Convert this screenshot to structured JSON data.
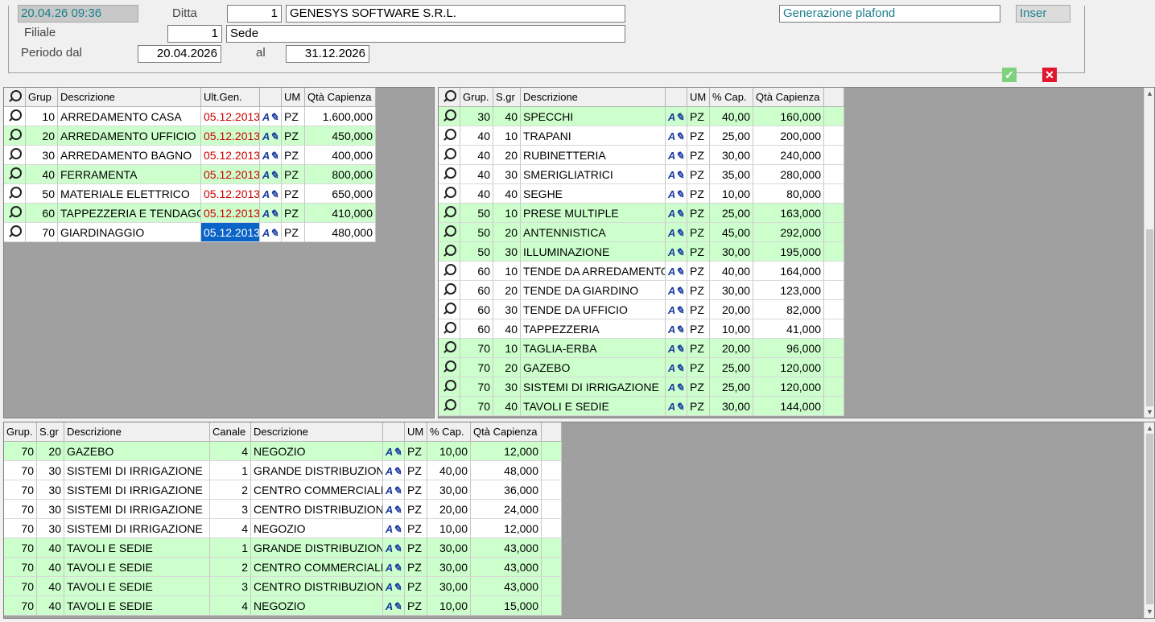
{
  "header": {
    "timestamp": "20.04.26 09:36",
    "ditta_label": "Ditta",
    "ditta_code": "1",
    "ditta_name": "GENESYS SOFTWARE S.R.L.",
    "filiale_label": "Filiale",
    "filiale_code": "1",
    "filiale_name": "Sede",
    "periodo_label": "Periodo dal",
    "periodo_from": "20.04.2026",
    "al_label": "al",
    "periodo_to": "31.12.2026",
    "title": "Generazione  plafond",
    "mode": "Inser",
    "ok_icon": "check-icon",
    "cancel_icon": "close-icon"
  },
  "groups_table": {
    "headers": [
      "",
      "Grup",
      "Descrizione",
      "Ult.Gen.",
      "",
      "UM",
      "Qtà Capienza"
    ],
    "rows": [
      {
        "grup": "10",
        "desc": "ARREDAMENTO CASA",
        "date": "05.12.2013",
        "um": "PZ",
        "qta": "1.600,000",
        "green": false
      },
      {
        "grup": "20",
        "desc": "ARREDAMENTO UFFICIO",
        "date": "05.12.2013",
        "um": "PZ",
        "qta": "450,000",
        "green": true
      },
      {
        "grup": "30",
        "desc": "ARREDAMENTO BAGNO",
        "date": "05.12.2013",
        "um": "PZ",
        "qta": "400,000",
        "green": false
      },
      {
        "grup": "40",
        "desc": "FERRAMENTA",
        "date": "05.12.2013",
        "um": "PZ",
        "qta": "800,000",
        "green": true
      },
      {
        "grup": "50",
        "desc": "MATERIALE ELETTRICO",
        "date": "05.12.2013",
        "um": "PZ",
        "qta": "650,000",
        "green": false
      },
      {
        "grup": "60",
        "desc": "TAPPEZZERIA E TENDAGGI",
        "date": "05.12.2013",
        "um": "PZ",
        "qta": "410,000",
        "green": true
      },
      {
        "grup": "70",
        "desc": "GIARDINAGGIO",
        "date": "05.12.2013",
        "um": "PZ",
        "qta": "480,000",
        "green": false,
        "selected": true
      }
    ]
  },
  "subgroups_table": {
    "headers": [
      "",
      "Grup.",
      "S.gr",
      "Descrizione",
      "",
      "UM",
      "% Cap.",
      "Qtà Capienza"
    ],
    "rows": [
      {
        "grup": "30",
        "sgr": "40",
        "desc": "SPECCHI",
        "um": "PZ",
        "cap": "40,00",
        "qta": "160,000",
        "green": true
      },
      {
        "grup": "40",
        "sgr": "10",
        "desc": "TRAPANI",
        "um": "PZ",
        "cap": "25,00",
        "qta": "200,000",
        "green": false
      },
      {
        "grup": "40",
        "sgr": "20",
        "desc": "RUBINETTERIA",
        "um": "PZ",
        "cap": "30,00",
        "qta": "240,000",
        "green": false
      },
      {
        "grup": "40",
        "sgr": "30",
        "desc": "SMERIGLIATRICI",
        "um": "PZ",
        "cap": "35,00",
        "qta": "280,000",
        "green": false
      },
      {
        "grup": "40",
        "sgr": "40",
        "desc": "SEGHE",
        "um": "PZ",
        "cap": "10,00",
        "qta": "80,000",
        "green": false
      },
      {
        "grup": "50",
        "sgr": "10",
        "desc": "PRESE MULTIPLE",
        "um": "PZ",
        "cap": "25,00",
        "qta": "163,000",
        "green": true
      },
      {
        "grup": "50",
        "sgr": "20",
        "desc": "ANTENNISTICA",
        "um": "PZ",
        "cap": "45,00",
        "qta": "292,000",
        "green": true
      },
      {
        "grup": "50",
        "sgr": "30",
        "desc": "ILLUMINAZIONE",
        "um": "PZ",
        "cap": "30,00",
        "qta": "195,000",
        "green": true
      },
      {
        "grup": "60",
        "sgr": "10",
        "desc": "TENDE DA ARREDAMENTO",
        "um": "PZ",
        "cap": "40,00",
        "qta": "164,000",
        "green": false
      },
      {
        "grup": "60",
        "sgr": "20",
        "desc": "TENDE DA GIARDINO",
        "um": "PZ",
        "cap": "30,00",
        "qta": "123,000",
        "green": false
      },
      {
        "grup": "60",
        "sgr": "30",
        "desc": "TENDE DA UFFICIO",
        "um": "PZ",
        "cap": "20,00",
        "qta": "82,000",
        "green": false
      },
      {
        "grup": "60",
        "sgr": "40",
        "desc": "TAPPEZZERIA",
        "um": "PZ",
        "cap": "10,00",
        "qta": "41,000",
        "green": false
      },
      {
        "grup": "70",
        "sgr": "10",
        "desc": "TAGLIA-ERBA",
        "um": "PZ",
        "cap": "20,00",
        "qta": "96,000",
        "green": true
      },
      {
        "grup": "70",
        "sgr": "20",
        "desc": "GAZEBO",
        "um": "PZ",
        "cap": "25,00",
        "qta": "120,000",
        "green": true
      },
      {
        "grup": "70",
        "sgr": "30",
        "desc": "SISTEMI DI IRRIGAZIONE",
        "um": "PZ",
        "cap": "25,00",
        "qta": "120,000",
        "green": true
      },
      {
        "grup": "70",
        "sgr": "40",
        "desc": "TAVOLI E SEDIE",
        "um": "PZ",
        "cap": "30,00",
        "qta": "144,000",
        "green": true
      }
    ]
  },
  "channels_table": {
    "headers": [
      "Grup.",
      "S.gr",
      "Descrizione",
      "Canale",
      "Descrizione",
      "",
      "UM",
      "% Cap.",
      "Qtà Capienza"
    ],
    "rows": [
      {
        "grup": "70",
        "sgr": "20",
        "desc": "GAZEBO",
        "canale": "4",
        "cdesc": "NEGOZIO",
        "um": "PZ",
        "cap": "10,00",
        "qta": "12,000",
        "green": true
      },
      {
        "grup": "70",
        "sgr": "30",
        "desc": "SISTEMI DI IRRIGAZIONE",
        "canale": "1",
        "cdesc": "GRANDE DISTRIBUZIONE",
        "um": "PZ",
        "cap": "40,00",
        "qta": "48,000",
        "green": false
      },
      {
        "grup": "70",
        "sgr": "30",
        "desc": "SISTEMI DI IRRIGAZIONE",
        "canale": "2",
        "cdesc": "CENTRO COMMERCIALE",
        "um": "PZ",
        "cap": "30,00",
        "qta": "36,000",
        "green": false
      },
      {
        "grup": "70",
        "sgr": "30",
        "desc": "SISTEMI DI IRRIGAZIONE",
        "canale": "3",
        "cdesc": "CENTRO DISTRIBUZIONE",
        "um": "PZ",
        "cap": "20,00",
        "qta": "24,000",
        "green": false
      },
      {
        "grup": "70",
        "sgr": "30",
        "desc": "SISTEMI DI IRRIGAZIONE",
        "canale": "4",
        "cdesc": "NEGOZIO",
        "um": "PZ",
        "cap": "10,00",
        "qta": "12,000",
        "green": false
      },
      {
        "grup": "70",
        "sgr": "40",
        "desc": "TAVOLI E SEDIE",
        "canale": "1",
        "cdesc": "GRANDE DISTRIBUZIONE",
        "um": "PZ",
        "cap": "30,00",
        "qta": "43,000",
        "green": true
      },
      {
        "grup": "70",
        "sgr": "40",
        "desc": "TAVOLI E SEDIE",
        "canale": "2",
        "cdesc": "CENTRO COMMERCIALE",
        "um": "PZ",
        "cap": "30,00",
        "qta": "43,000",
        "green": true
      },
      {
        "grup": "70",
        "sgr": "40",
        "desc": "TAVOLI E SEDIE",
        "canale": "3",
        "cdesc": "CENTRO DISTRIBUZIONE",
        "um": "PZ",
        "cap": "30,00",
        "qta": "43,000",
        "green": true
      },
      {
        "grup": "70",
        "sgr": "40",
        "desc": "TAVOLI E SEDIE",
        "canale": "4",
        "cdesc": "NEGOZIO",
        "um": "PZ",
        "cap": "10,00",
        "qta": "15,000",
        "green": true
      }
    ]
  },
  "colors": {
    "row_green": "#ccffcc",
    "date_red": "#d00000",
    "selected": "#0a64c8",
    "teal": "#1a7f8c"
  }
}
